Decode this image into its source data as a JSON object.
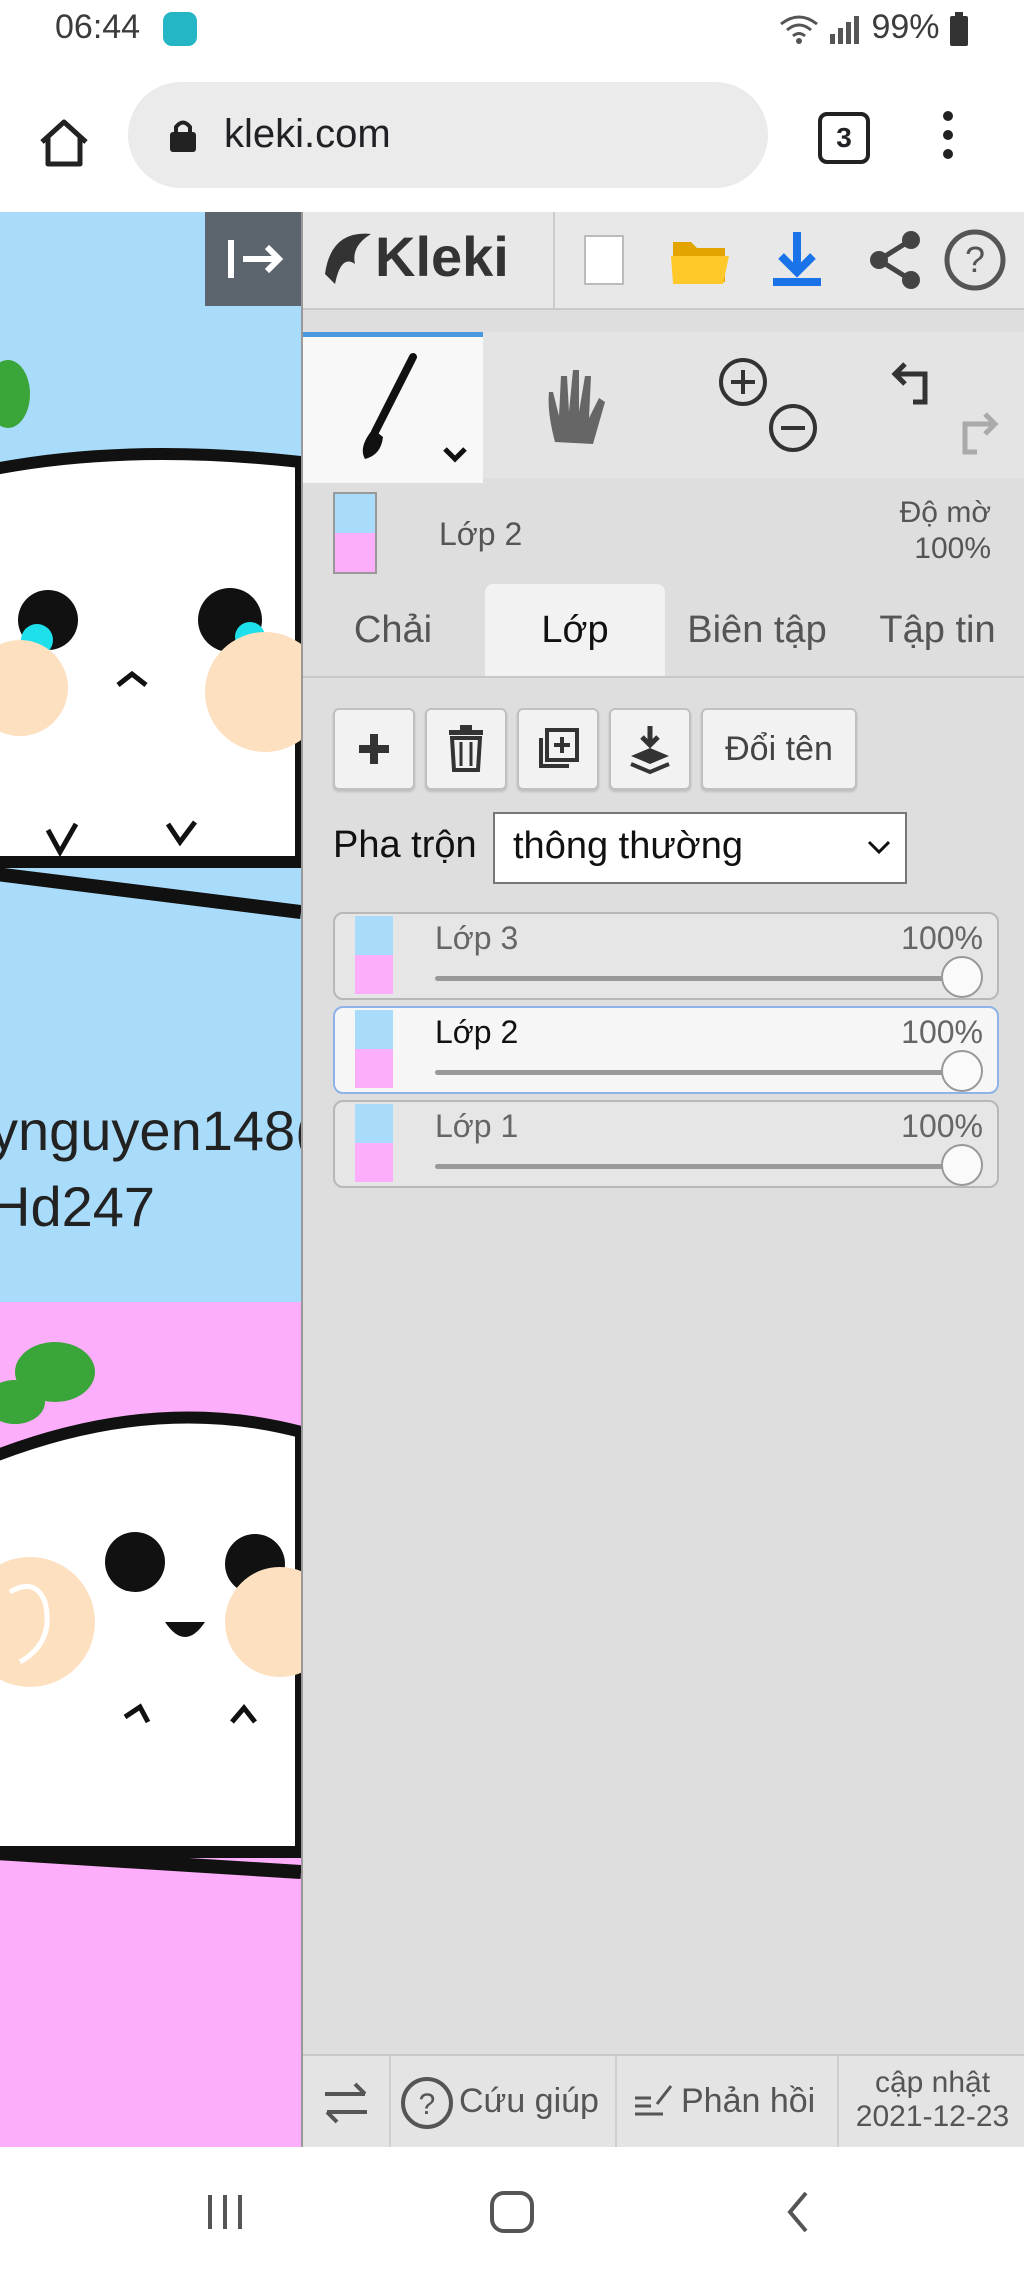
{
  "status_bar": {
    "time": "06:44",
    "battery": "99%"
  },
  "browser": {
    "url": "kleki.com",
    "tab_count": "3"
  },
  "canvas": {
    "text_line1": "ynguyen148(",
    "text_line2": "Hd247"
  },
  "app": {
    "name": "Kleki"
  },
  "layer_info": {
    "name": "Lớp 2",
    "opacity_label": "Độ mờ",
    "opacity_value": "100%"
  },
  "tabs": [
    {
      "label": "Chải",
      "selected": false
    },
    {
      "label": "Lớp",
      "selected": true
    },
    {
      "label": "Biên tập",
      "selected": false
    },
    {
      "label": "Tập tin",
      "selected": false
    }
  ],
  "layer_actions": {
    "rename_label": "Đổi tên"
  },
  "blend": {
    "label": "Pha trộn",
    "value": "thông thường"
  },
  "layers": [
    {
      "name": "Lớp 3",
      "opacity": "100%",
      "selected": false
    },
    {
      "name": "Lớp 2",
      "opacity": "100%",
      "selected": true
    },
    {
      "name": "Lớp 1",
      "opacity": "100%",
      "selected": false
    }
  ],
  "footer": {
    "help_label": "Cứu giúp",
    "feedback_label": "Phản hồi",
    "update_label": "cập nhật",
    "update_date": "2021-12-23"
  },
  "colors": {
    "accent": "#1a73e8",
    "canvas_blue": "#a9dcfa",
    "canvas_pink": "#fdaefa",
    "panel_bg": "#dedede"
  }
}
